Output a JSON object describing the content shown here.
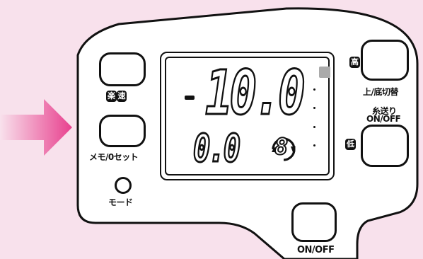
{
  "buttons": {
    "raku_soku_label_a": "楽",
    "raku_soku_label_b": "速",
    "memo_label": "メモ/0セット",
    "mode_label": "モード",
    "high_badge": "高",
    "low_badge": "低",
    "switch_label": "上/底切替",
    "feed_label_line1": "糸送り",
    "feed_label_line2": "ON/OFF",
    "power_label": "ON/OFF"
  },
  "display": {
    "sign": "-",
    "depth": "10.0",
    "line_length": "0.0",
    "memo_number": "8"
  },
  "colors": {
    "background": "#f8e1ec",
    "arrow": "#e8408e",
    "panel": "#ffffff"
  }
}
